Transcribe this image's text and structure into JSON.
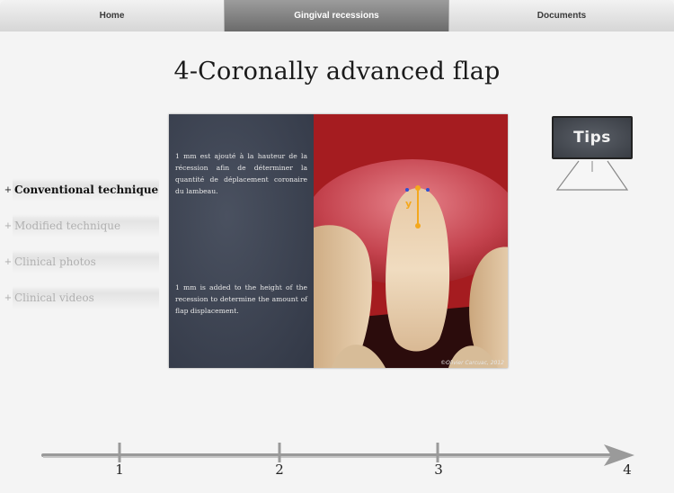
{
  "tabs": [
    {
      "label": "Home",
      "selected": false
    },
    {
      "label": "Gingival recessions",
      "selected": true
    },
    {
      "label": "Documents",
      "selected": false
    }
  ],
  "page_title": "4-Coronally advanced flap",
  "menu": [
    {
      "label": "Conventional technique",
      "active": true
    },
    {
      "label": "Modified technique",
      "active": false
    },
    {
      "label": "Clinical photos",
      "active": false
    },
    {
      "label": "Clinical videos",
      "active": false
    }
  ],
  "menu_bullet": "+",
  "slide": {
    "text_fr": "1 mm est ajouté à la hauteur de la récession afin de déterminer la quantité de déplacement coronaire du lambeau.",
    "text_en": "1 mm is added to the height of the recession to determine the amount of flap displacement.",
    "measure_label": "y",
    "credit": "©Olivier Carcuac, 2012"
  },
  "tips": {
    "label": "Tips"
  },
  "timeline": {
    "steps": [
      "1",
      "2",
      "3",
      "4"
    ],
    "current": "4"
  },
  "colors": {
    "tab_selected": "#7d7d7d",
    "slide_text_bg": "#3d4352",
    "tips_board": "#4a4e55",
    "measure": "#f4a81d"
  }
}
